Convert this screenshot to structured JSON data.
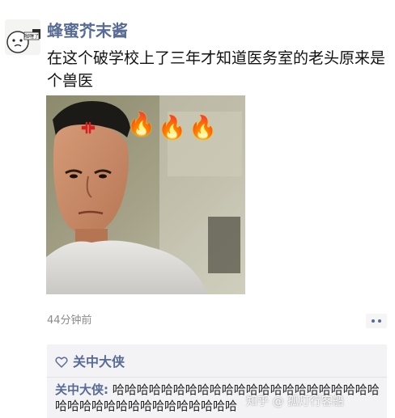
{
  "post": {
    "author_name": "蜂蜜芥末酱",
    "text": "在这个破学校上了三年才知道医务室的老头原来是个兽医",
    "avatar_caption": "咖喱了",
    "time": "44分钟前"
  },
  "comments": {
    "like_name": "关中大侠",
    "items": [
      {
        "author": "关中大侠:",
        "text": "哈哈哈哈哈哈哈哈哈哈哈哈哈哈哈哈哈哈哈哈哈哈哈哈哈哈哈哈哈哈哈哈哈哈哈哈哈"
      }
    ]
  },
  "watermark": "知乎 @ 孤灯行客船",
  "colors": {
    "name": "#576b95",
    "text": "#111111",
    "time": "#8b8b8b",
    "comment_bg": "#f3f3f5",
    "flame": "#ff6a00",
    "anger_mark": "#d81e1e"
  }
}
